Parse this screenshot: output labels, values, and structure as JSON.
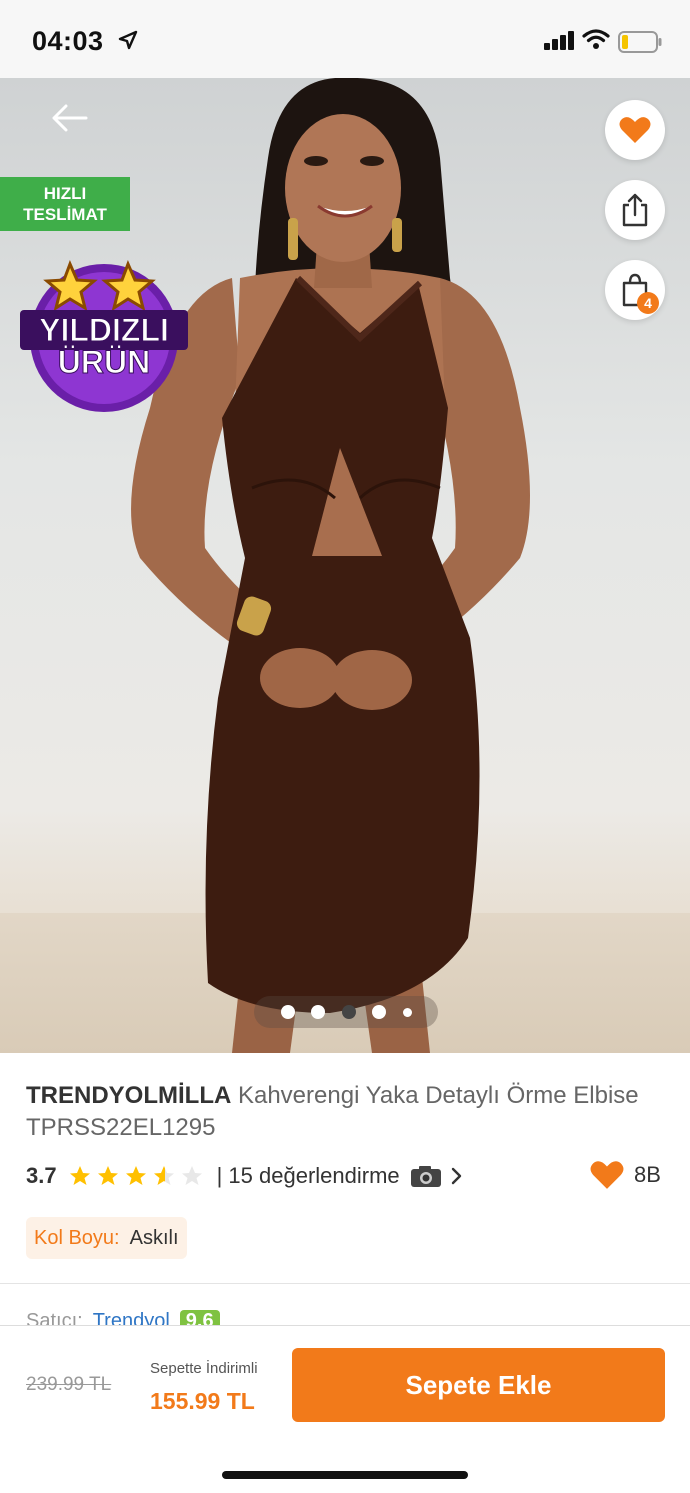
{
  "status_bar": {
    "time": "04:03"
  },
  "badges": {
    "fast_delivery": "HIZLI\nTESLİMAT",
    "star_line1": "YILDIZLI",
    "star_line2": "ÜRÜN"
  },
  "header": {
    "cart_count": "4"
  },
  "gallery": {
    "total_dots": 5,
    "active_index": 2
  },
  "product": {
    "brand": "TRENDYOLMİLLA",
    "name": " Kahverengi Yaka Detaylı Örme Elbise TPRSS22EL1295",
    "rating": "3.7",
    "rating_value": 3.7,
    "review_text": "| 15 değerlendirme",
    "favorites": "8B",
    "attribute_label": "Kol Boyu:",
    "attribute_value": "Askılı"
  },
  "seller_peek": {
    "label": "Satıcı:",
    "name": "Trendyol",
    "score": "9.6"
  },
  "purchase": {
    "old_price": "239.99 TL",
    "discount_label": "Sepette İndirimli",
    "new_price": "155.99 TL",
    "cart_button": "Sepete Ekle"
  },
  "colors": {
    "accent": "#f27a1a",
    "fast_green": "#3fae49"
  }
}
